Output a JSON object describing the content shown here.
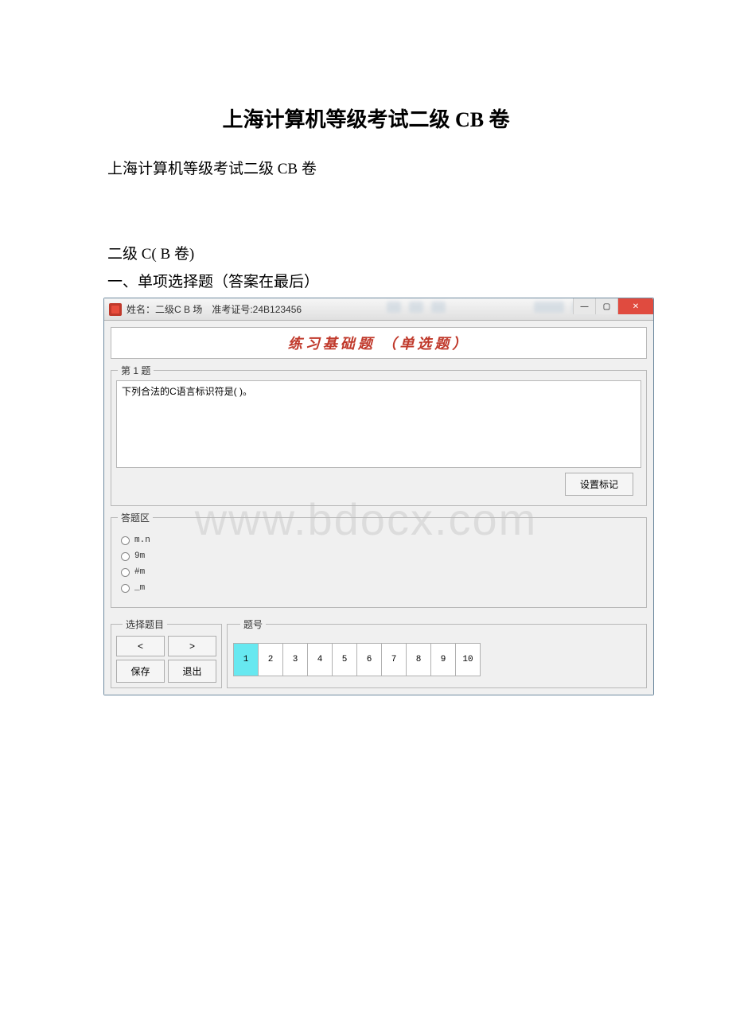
{
  "document": {
    "title": "上海计算机等级考试二级 CB 卷",
    "subtitle": "上海计算机等级考试二级 CB 卷",
    "section_label_1": "二级 C( B 卷)",
    "section_label_2": "一、单项选择题（答案在最后）"
  },
  "window": {
    "title_prefix": "姓名：二级C B 场",
    "title_suffix": "准考证号:24B123456",
    "controls": {
      "minimize": "—",
      "maximize": "▢",
      "close": "✕"
    }
  },
  "panel": {
    "heading": "练习基础题 （单选题）"
  },
  "question": {
    "legend": "第 1 题",
    "text": "下列合法的C语言标识符是(    )。",
    "mark_button": "设置标记"
  },
  "answers": {
    "legend": "答题区",
    "options": [
      "m.n",
      "9m",
      "#m",
      "_m"
    ]
  },
  "navigation": {
    "select_legend": "选择题目",
    "numbers_legend": "题号",
    "prev": "<",
    "next": ">",
    "save": "保存",
    "exit": "退出",
    "numbers": [
      "1",
      "2",
      "3",
      "4",
      "5",
      "6",
      "7",
      "8",
      "9",
      "10"
    ],
    "active_index": 0
  },
  "watermark": "www.bdocx.com"
}
